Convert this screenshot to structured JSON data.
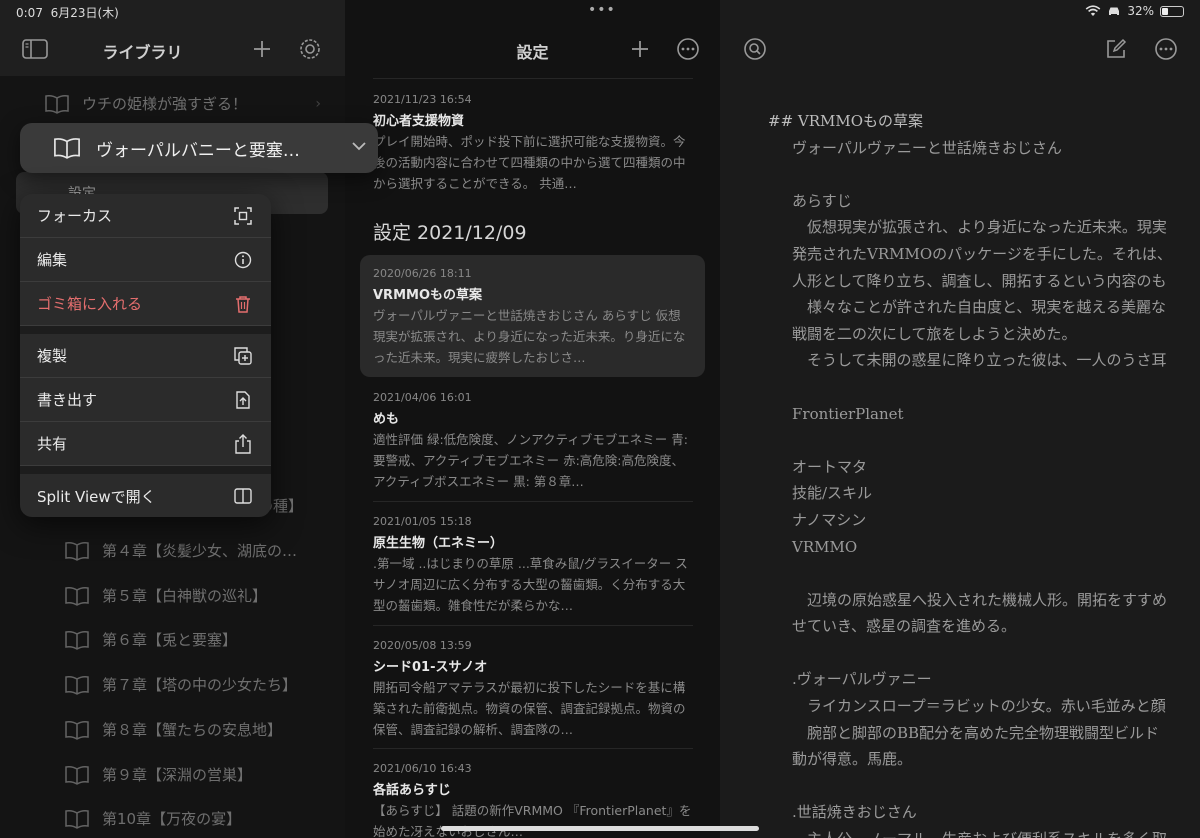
{
  "status": {
    "time": "0:07",
    "date": "6月23日(木)",
    "battery": "32%",
    "battery_level": 0.32
  },
  "library": {
    "title": "ライブラリ",
    "items": [
      {
        "label": "ウチの姫様が強すぎる！"
      },
      {
        "label": "第４章【炎髪少女、湖底の…"
      },
      {
        "label": "第５章【白神獣の巡礼】"
      },
      {
        "label": "第６章【兎と要塞】"
      },
      {
        "label": "第７章【塔の中の少女たち】"
      },
      {
        "label": "第８章【蟹たちの安息地】"
      },
      {
        "label": "第９章【深淵の営巣】"
      },
      {
        "label": "第10章【万夜の宴】"
      }
    ],
    "hidden_tail_1": "】",
    "hidden_tail_2": "の種】",
    "focused_book": "ヴォーパルバニーと要塞…",
    "sub_setting": "設定"
  },
  "context_menu": {
    "items": [
      {
        "label": "フォーカス",
        "icon": "focus-icon"
      },
      {
        "label": "編集",
        "icon": "info-icon"
      },
      {
        "label": "ゴミ箱に入れる",
        "icon": "trash-icon"
      },
      {
        "label": "複製",
        "icon": "duplicate-icon"
      },
      {
        "label": "書き出す",
        "icon": "export-icon"
      },
      {
        "label": "共有",
        "icon": "share-icon"
      },
      {
        "label": "Split Viewで開く",
        "icon": "split-view-icon"
      }
    ]
  },
  "notes": {
    "title": "設定",
    "section": "設定 2021/12/09",
    "list": [
      {
        "date": "2021/11/23 16:54",
        "title": "初心者支援物資",
        "excerpt": "プレイ開始時、ポッド投下前に選択可能な支援物資。今後の活動内容に合わせて四種類の中から選て四種類の中から選択することができる。 共通…"
      },
      {
        "date": "2020/06/26 18:11",
        "title": "VRMMOもの草案",
        "excerpt": "ヴォーパルヴァニーと世話焼きおじさん あらすじ 仮想現実が拡張され、より身近になった近未来。り身近になった近未来。現実に疲弊したおじさ…"
      },
      {
        "date": "2021/04/06 16:01",
        "title": "めも",
        "excerpt": "適性評価 緑:低危険度、ノンアクティブモブエネミー 青:要警戒、アクティブモブエネミー 赤:高危険:高危険度、アクティブボスエネミー 黒: 第８章…"
      },
      {
        "date": "2021/01/05 15:18",
        "title": "原生生物（エネミー）",
        "excerpt": ".第一域 ..はじまりの草原 ...草食み鼠/グラスイーター スサノオ周辺に広く分布する大型の齧歯類。く分布する大型の齧歯類。雑食性だが柔らかな…"
      },
      {
        "date": "2020/05/08 13:59",
        "title": "シード01-スサノオ",
        "excerpt": "開拓司令船アマテラスが最初に投下したシードを基に構築された前衛拠点。物資の保管、調査記録拠点。物資の保管、調査記録の解析、調査隊の…"
      },
      {
        "date": "2021/06/10 16:43",
        "title": "各話あらすじ",
        "excerpt": "【あらすじ】 話題の新作VRMMO 『FrontierPlanet』を始めた冴えないおじさん…"
      }
    ]
  },
  "editor": {
    "lines": [
      "## VRMMOもの草案",
      "ヴォーパルヴァニーと世話焼きおじさん",
      "",
      "あらすじ",
      "　仮想現実が拡張され、より身近になった近未来。現実",
      "発売されたVRMMOのパッケージを手にした。それは、",
      "人形として降り立ち、調査し、開拓するという内容のも",
      "　様々なことが許された自由度と、現実を越える美麗な",
      "戦闘を二の次にして旅をしようと決めた。",
      "　そうして未開の惑星に降り立った彼は、一人のうさ耳",
      "",
      "FrontierPlanet",
      "",
      "オートマタ",
      "技能/スキル",
      "ナノマシン",
      "VRMMO",
      "",
      "　辺境の原始惑星へ投入された機械人形。開拓をすすめ",
      "せていき、惑星の調査を進める。",
      "",
      ".ヴォーパルヴァニー",
      "　ライカンスロープ＝ラビットの少女。赤い毛並みと顔",
      "　腕部と脚部のBB配分を高めた完全物理戦闘型ビルド",
      "動が得意。馬鹿。",
      "",
      ".世話焼きおじさん",
      "　主人公。ノーマル、生産および便利系スキルを多く取"
    ]
  }
}
